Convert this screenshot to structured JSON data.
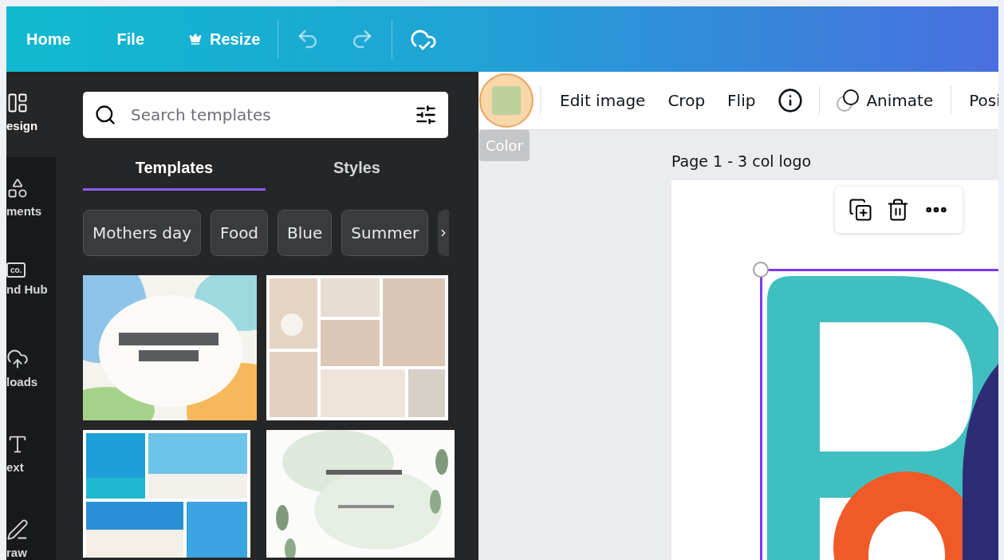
{
  "nav": {
    "items": [
      {
        "label": "Home",
        "kind": "text"
      },
      {
        "label": "File",
        "kind": "text"
      },
      {
        "label": "Resize",
        "kind": "premium"
      }
    ]
  },
  "sidebar": {
    "items": [
      {
        "label": "esign",
        "selected": true
      },
      {
        "label": "ments",
        "selected": false
      },
      {
        "label": "nd Hub",
        "icon_text": "co.",
        "selected": false
      },
      {
        "label": "loads",
        "selected": false
      },
      {
        "label": "ext",
        "selected": false
      },
      {
        "label": "raw",
        "selected": false
      }
    ]
  },
  "panel": {
    "search": {
      "placeholder": "Search templates"
    },
    "tabs": [
      {
        "label": "Templates",
        "selected": true
      },
      {
        "label": "Styles",
        "selected": false
      }
    ],
    "chips": [
      "Mothers day",
      "Food",
      "Blue",
      "Summer"
    ]
  },
  "toolbar": {
    "swatch": {
      "color": "#bdd19b",
      "highlighted": true,
      "tooltip": "Color"
    },
    "actions": [
      "Edit image",
      "Crop",
      "Flip"
    ],
    "animate": "Animate",
    "position": "Posi"
  },
  "canvas": {
    "page_title": "Page 1 - 3 col logo"
  }
}
